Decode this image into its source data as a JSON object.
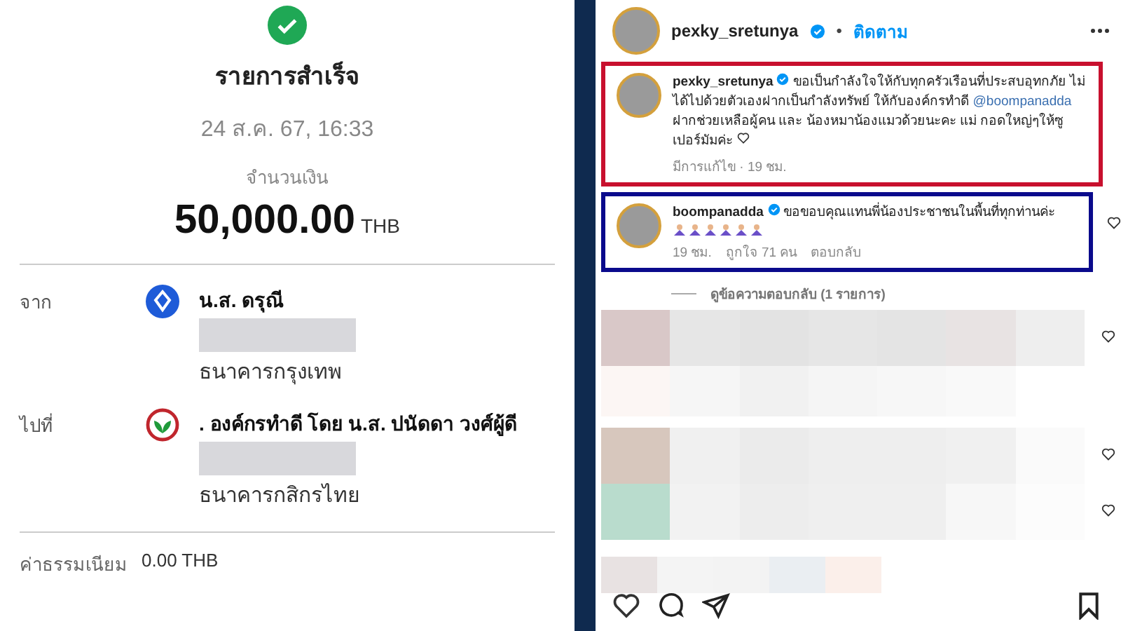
{
  "slip": {
    "status": "รายการสำเร็จ",
    "datetime": "24 ส.ค. 67, 16:33",
    "amount_label": "จำนวนเงิน",
    "amount": "50,000.00",
    "currency": "THB",
    "parties": [
      {
        "label": "จาก",
        "kind": "blue-bank",
        "name": "น.ส. ดรุณี",
        "bank": "ธนาคารกรุงเทพ"
      },
      {
        "label": "ไปที่",
        "kind": "green-bank",
        "name": ". องค์กรทำดี โดย น.ส. ปนัดดา  วงศ์ผู้ดี",
        "bank": "ธนาคารกสิกรไทย"
      }
    ],
    "fee_label": "ค่าธรรมเนียม",
    "fee": "0.00 THB"
  },
  "post": {
    "author": "pexky_sretunya",
    "verified": true,
    "separator": "•",
    "follow": "ติดตาม",
    "comments": [
      {
        "username": "pexky_sretunya",
        "verified": true,
        "color": "#c8102e",
        "parts": [
          {
            "kind": "text",
            "text": "ขอเป็นกำลังใจให้กับทุกครัวเรือนที่ประสบอุทกภัย ไม่ได้ไปด้วยตัวเองฝากเป็นกำลังทรัพย์ ให้กับองค์กรทำดี "
          },
          {
            "kind": "mention",
            "text": "@boompanadda"
          },
          {
            "kind": "text",
            "text": " ฝากช่วยเหลือผู้คน และ น้องหมาน้องแมวด้วยนะคะ แม่ กอดใหญ่ๆให้ซูเปอร์มัมค่ะ"
          }
        ],
        "reaction_emojis": false,
        "meta": [
          "มีการแก้ไข · 19 ชม."
        ],
        "side_heart": false
      },
      {
        "username": "boompanadda",
        "verified": true,
        "color": "#0a0a8c",
        "parts": [
          {
            "kind": "text",
            "text": "ขอขอบคุณแทนพี่น้องประชาชนในพื้นที่ทุกท่านค่ะ"
          }
        ],
        "reaction_emojis": true,
        "meta": [
          "19 ชม.",
          "ถูกใจ 71 คน",
          "ตอบกลับ"
        ],
        "side_heart": true
      }
    ],
    "replies_link": "ดูข้อความตอบกลับ (1 รายการ)"
  }
}
